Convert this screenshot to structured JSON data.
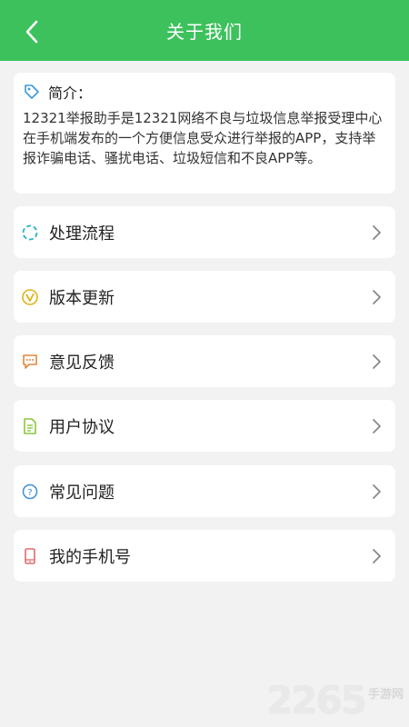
{
  "header": {
    "title": "关于我们",
    "back_icon": "chevron-left-icon"
  },
  "intro": {
    "icon": "tag-icon",
    "title": "简介：",
    "text": "12321举报助手是12321网络不良与垃圾信息举报受理中心在手机端发布的一个方便信息受众进行举报的APP，支持举报诈骗电话、骚扰电话、垃圾短信和不良APP等。"
  },
  "menu": [
    {
      "label": "处理流程",
      "icon": "loop-icon",
      "color": "#2bb3c8"
    },
    {
      "label": "版本更新",
      "icon": "version-v-icon",
      "color": "#e0b21a"
    },
    {
      "label": "意见反馈",
      "icon": "chat-bubble-icon",
      "color": "#e5873a"
    },
    {
      "label": "用户协议",
      "icon": "document-icon",
      "color": "#8cc63f"
    },
    {
      "label": "常见问题",
      "icon": "question-icon",
      "color": "#3e8fd8"
    },
    {
      "label": "我的手机号",
      "icon": "phone-icon",
      "color": "#e06a6a"
    }
  ],
  "watermark": {
    "number": "2265",
    "suffix": "手游网"
  },
  "colors": {
    "header_green": "#3dc15d",
    "background": "#f2f2f2"
  }
}
